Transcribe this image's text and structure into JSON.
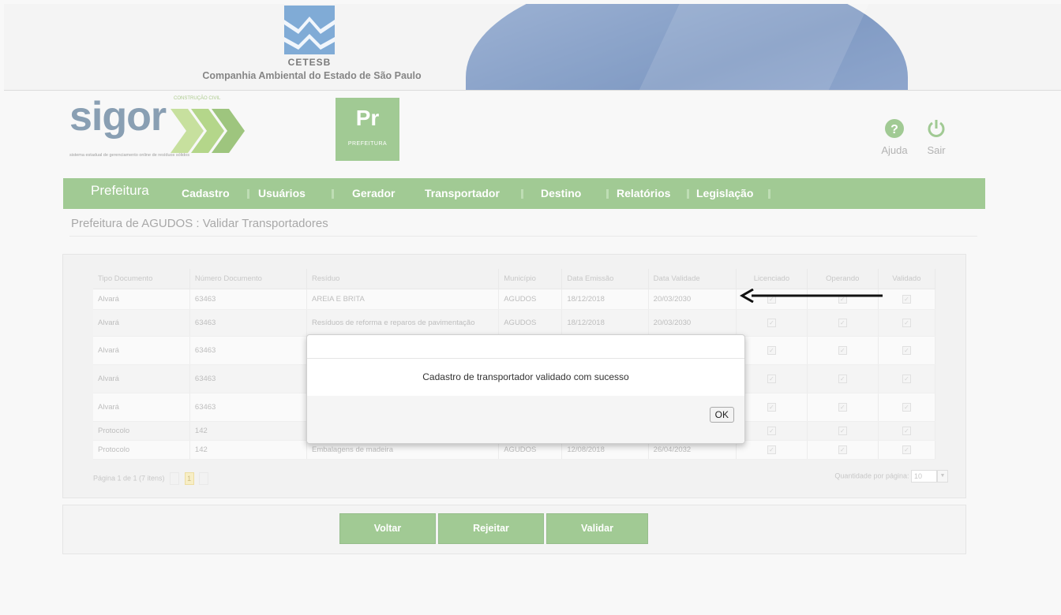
{
  "header": {
    "org_name": "CETESB",
    "org_subtitle": "Companhia Ambiental do Estado de São Paulo"
  },
  "brand": {
    "name": "sigor",
    "tagline": "CONSTRUÇÃO CIVIL",
    "subtitle": "sistema estadual de gerenciamento online de resíduos sólidos",
    "module_code": "Pr",
    "module_name": "PREFEITURA",
    "accent_color": "#6fae5b"
  },
  "user_actions": {
    "help_label": "Ajuda",
    "exit_label": "Sair"
  },
  "menu": {
    "items": [
      "Prefeitura",
      "Cadastro",
      "Usuários",
      "Gerador",
      "Transportador",
      "Destino",
      "Relatórios",
      "Legislação"
    ]
  },
  "page": {
    "title": "Prefeitura de AGUDOS : Validar Transportadores"
  },
  "grid": {
    "columns": [
      "Tipo Documento",
      "Número Documento",
      "Resíduo",
      "Município",
      "Data Emissão",
      "Data Validade",
      "Licenciado",
      "Operando",
      "Validado"
    ],
    "rows": [
      {
        "tipo": "Alvará",
        "numero": "63463",
        "residuo": "AREIA E BRITA",
        "municipio": "AGUDOS",
        "emissao": "18/12/2018",
        "validade": "20/03/2030"
      },
      {
        "tipo": "Alvará",
        "numero": "63463",
        "residuo": "Resíduos de reforma e reparos de pavimentação",
        "municipio": "AGUDOS",
        "emissao": "18/12/2018",
        "validade": "20/03/2030"
      },
      {
        "tipo": "Alvará",
        "numero": "63463",
        "residuo": "",
        "municipio": "",
        "emissao": "",
        "validade": ""
      },
      {
        "tipo": "Alvará",
        "numero": "63463",
        "residuo": "",
        "municipio": "",
        "emissao": "",
        "validade": ""
      },
      {
        "tipo": "Alvará",
        "numero": "63463",
        "residuo": "",
        "municipio": "",
        "emissao": "",
        "validade": ""
      },
      {
        "tipo": "Protocolo",
        "numero": "142",
        "residuo": "",
        "municipio": "",
        "emissao": "",
        "validade": ""
      },
      {
        "tipo": "Protocolo",
        "numero": "142",
        "residuo": "Embalagens de madeira",
        "municipio": "AGUDOS",
        "emissao": "12/08/2018",
        "validade": "26/04/2032"
      }
    ],
    "pager_text": "Página 1 de 1 (7 itens)",
    "current_page": "1",
    "qty_label": "Quantidade por página:",
    "qty_value": "10"
  },
  "buttons": {
    "back": "Voltar",
    "reject": "Rejeitar",
    "validate": "Validar"
  },
  "modal": {
    "message": "Cadastro de transportador validado com sucesso",
    "ok": "OK"
  }
}
